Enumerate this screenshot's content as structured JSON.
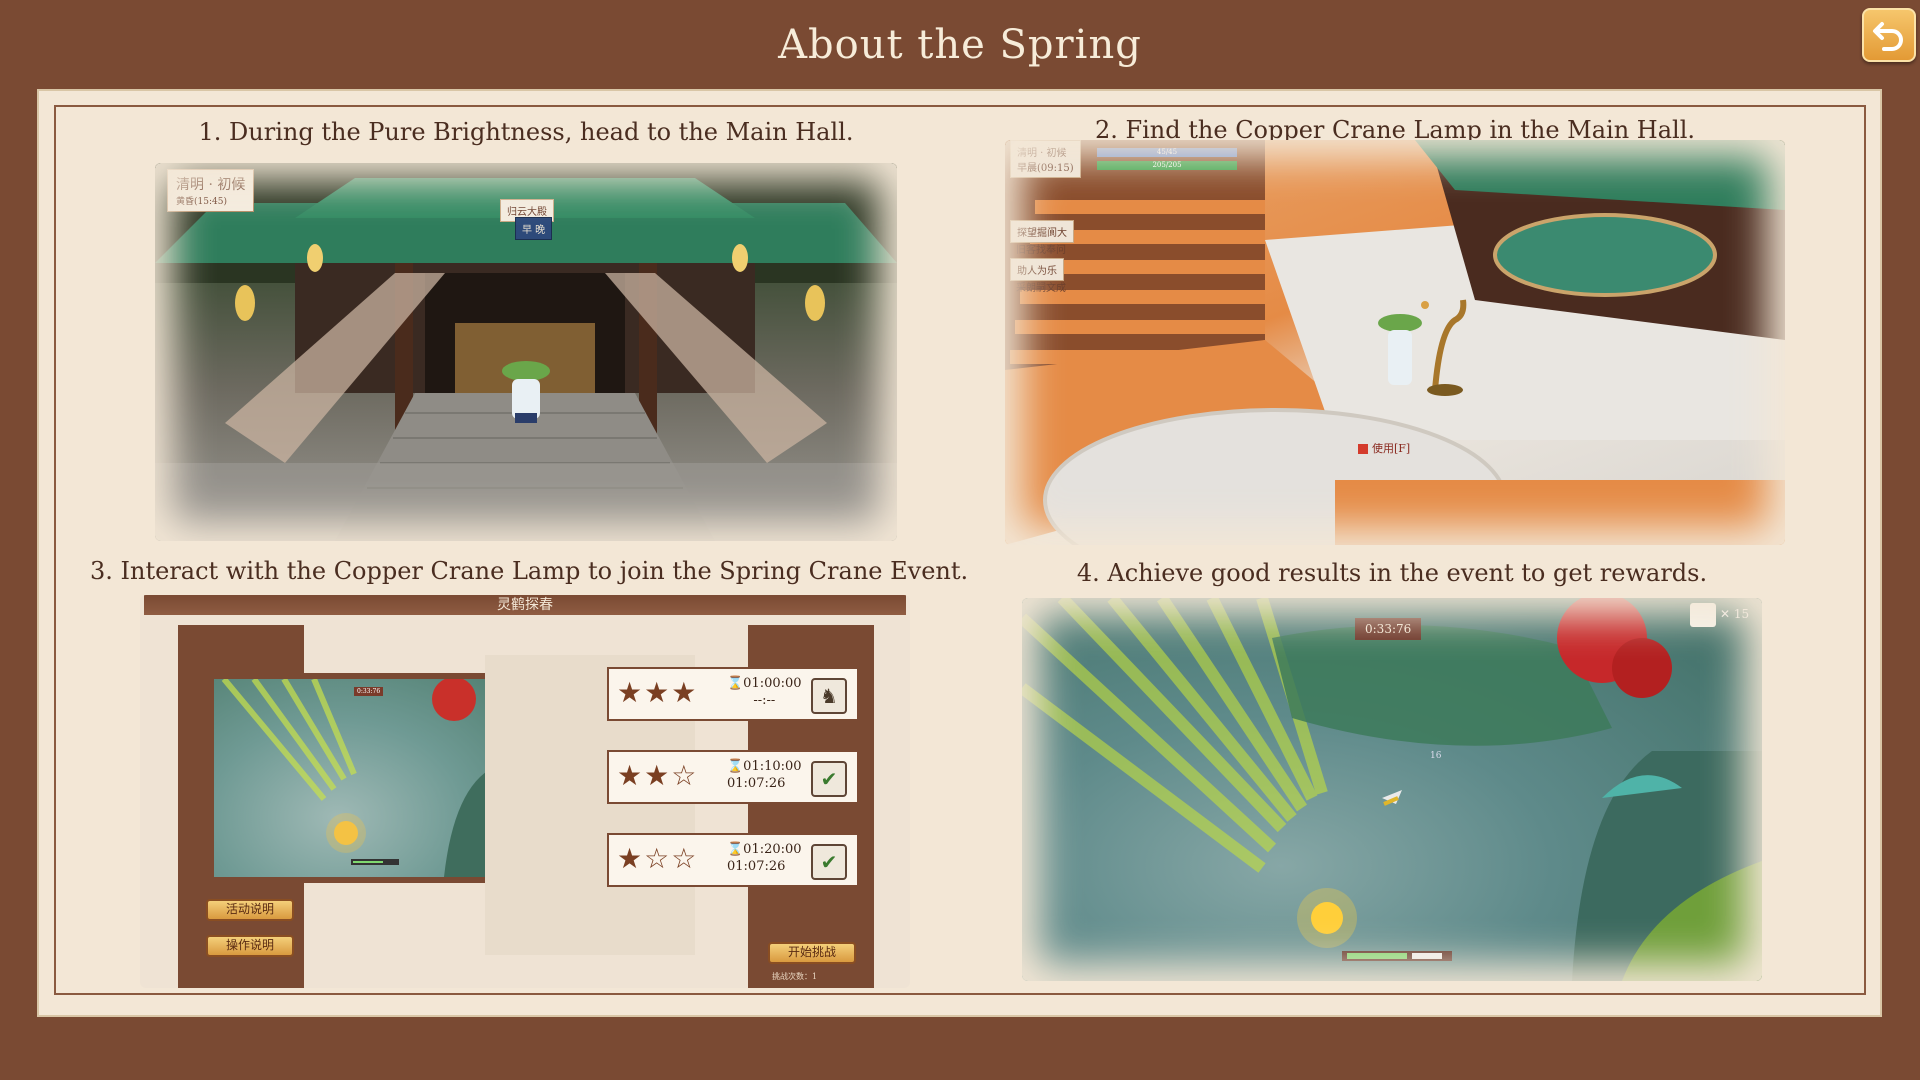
{
  "title": "About the Spring",
  "back_icon": "undo-arrow-icon",
  "steps": [
    {
      "text": "1. During the Pure Brightness, head to the Main Hall."
    },
    {
      "text": "2. Find the Copper Crane Lamp in the Main Hall."
    },
    {
      "text": "3. Interact with the Copper Crane Lamp to join the Spring Crane Event."
    },
    {
      "text": "4. Achieve good results in the event to get rewards."
    }
  ],
  "shot1": {
    "season_tag": "清明 · 初候",
    "season_sub": "黄昏(15:45)",
    "hall_sign": "归云大殿",
    "hall_plaque": "早 晚"
  },
  "shot2": {
    "season_tag": "清明 · 初候",
    "season_sub": "早晨(09:15)",
    "bar1": "45/45",
    "bar2": "205/205",
    "quests": [
      "探望掘阆大",
      "旧客找奉问",
      "助人为乐",
      "采朗嗣文成"
    ],
    "use_tag": "使用[F]"
  },
  "shot3": {
    "panel_title": "灵鹤探春",
    "mini_timer": "0:33:76",
    "btn_activity": "活动说明",
    "btn_controls": "操作说明",
    "btn_start": "开始挑战",
    "attempts": "挑战次数：1",
    "rows": [
      {
        "stars": "★★★",
        "target": "⌛01:00:00",
        "best": "--:--",
        "icon": "♞"
      },
      {
        "stars": "★★☆",
        "target": "⌛01:10:00",
        "best": "01:07:26",
        "icon": "✔"
      },
      {
        "stars": "★☆☆",
        "target": "⌛01:20:00",
        "best": "01:07:26",
        "icon": "✔"
      }
    ]
  },
  "shot4": {
    "timer": "0:33:76",
    "counter": "✕ 15",
    "mid_num": "16"
  }
}
